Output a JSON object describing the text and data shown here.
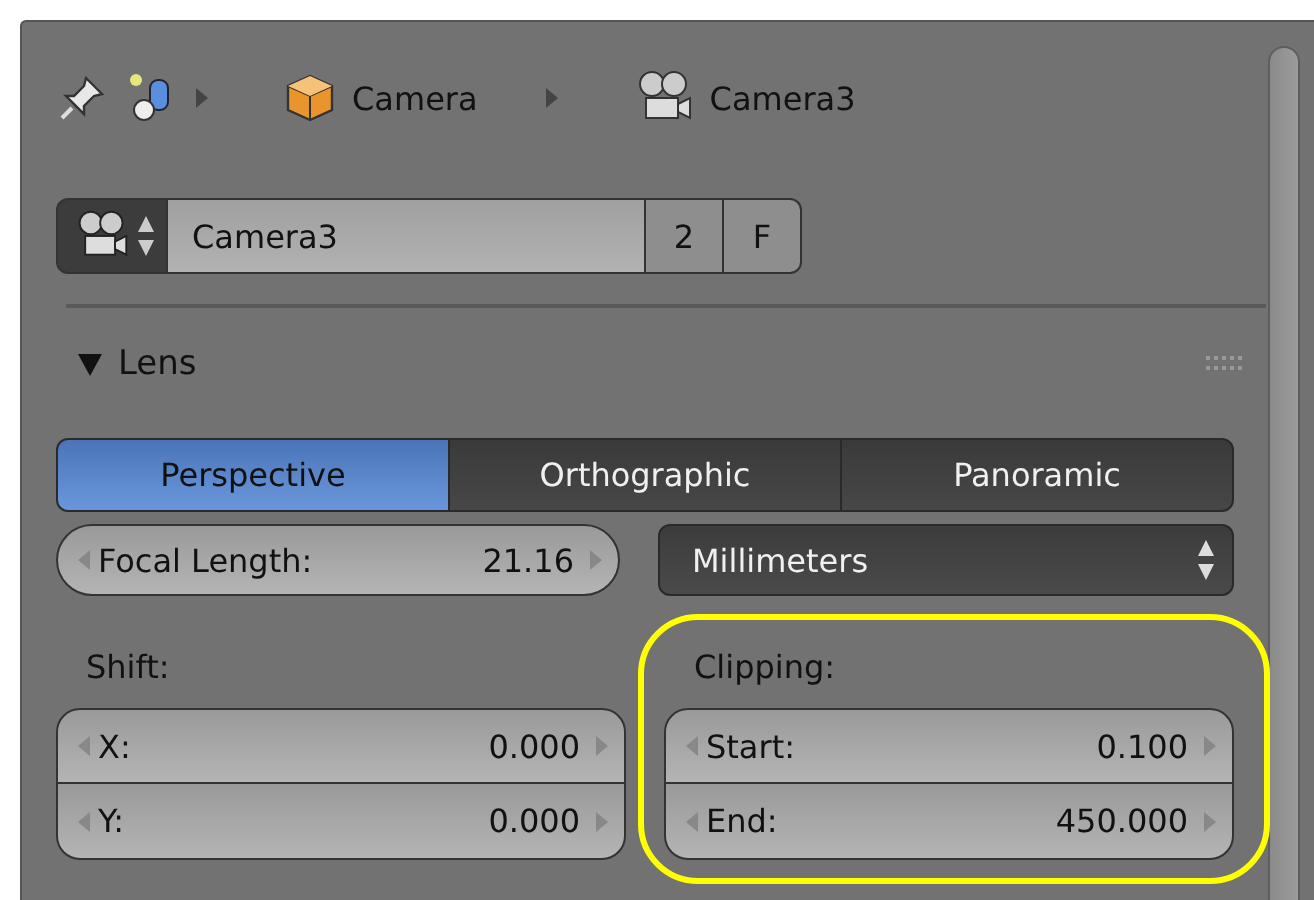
{
  "breadcrumb": [
    {
      "kind": "object",
      "label": "Camera"
    },
    {
      "kind": "camera",
      "label": "Camera3"
    }
  ],
  "datablock": {
    "name": "Camera3",
    "users": "2",
    "fake_user": "F"
  },
  "panel": {
    "title": "Lens",
    "expanded": true
  },
  "projection_tabs": [
    {
      "label": "Perspective",
      "selected": true
    },
    {
      "label": "Orthographic",
      "selected": false
    },
    {
      "label": "Panoramic",
      "selected": false
    }
  ],
  "focal_length": {
    "label": "Focal Length:",
    "value": "21.16"
  },
  "lens_unit": {
    "value": "Millimeters"
  },
  "shift": {
    "label": "Shift:",
    "fields": [
      {
        "label": "X:",
        "value": "0.000"
      },
      {
        "label": "Y:",
        "value": "0.000"
      }
    ]
  },
  "clipping": {
    "label": "Clipping:",
    "highlighted": true,
    "fields": [
      {
        "label": "Start:",
        "value": "0.100"
      },
      {
        "label": "End:",
        "value": "450.000"
      }
    ]
  }
}
